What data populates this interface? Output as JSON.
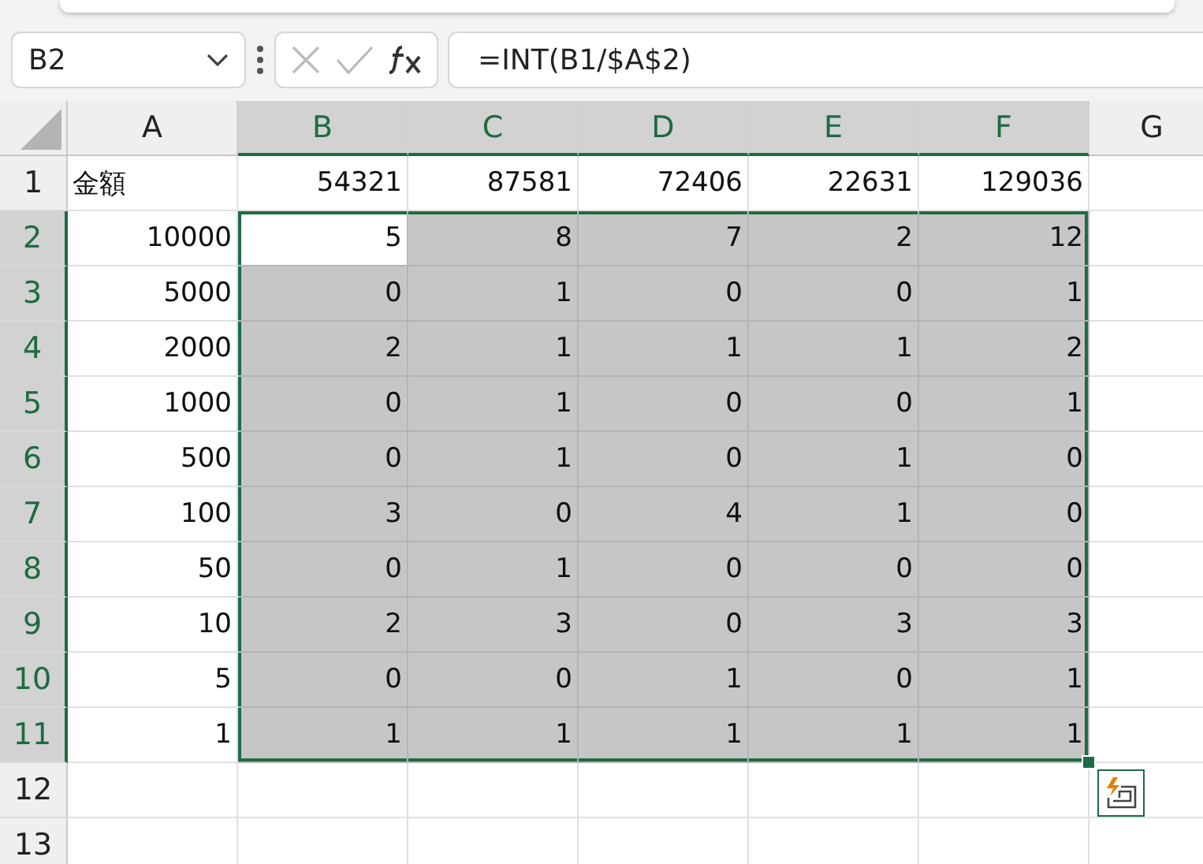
{
  "name_box": {
    "value": "B2"
  },
  "formula_bar": {
    "formula": "=INT(B1/$A$2)"
  },
  "columns": [
    {
      "label": "A",
      "selected": false
    },
    {
      "label": "B",
      "selected": true
    },
    {
      "label": "C",
      "selected": true
    },
    {
      "label": "D",
      "selected": true
    },
    {
      "label": "E",
      "selected": true
    },
    {
      "label": "F",
      "selected": true
    },
    {
      "label": "G",
      "selected": false
    }
  ],
  "rows": [
    {
      "label": "1",
      "selected": false,
      "cells": [
        {
          "value": "金額",
          "kind": "text",
          "selected": false,
          "active": false
        },
        {
          "value": "54321",
          "kind": "number",
          "selected": false,
          "active": false
        },
        {
          "value": "87581",
          "kind": "number",
          "selected": false,
          "active": false
        },
        {
          "value": "72406",
          "kind": "number",
          "selected": false,
          "active": false
        },
        {
          "value": "22631",
          "kind": "number",
          "selected": false,
          "active": false
        },
        {
          "value": "129036",
          "kind": "number",
          "selected": false,
          "active": false
        }
      ]
    },
    {
      "label": "2",
      "selected": true,
      "cells": [
        {
          "value": "10000",
          "kind": "number",
          "selected": false,
          "active": false
        },
        {
          "value": "5",
          "kind": "number",
          "selected": true,
          "active": true
        },
        {
          "value": "8",
          "kind": "number",
          "selected": true,
          "active": false
        },
        {
          "value": "7",
          "kind": "number",
          "selected": true,
          "active": false
        },
        {
          "value": "2",
          "kind": "number",
          "selected": true,
          "active": false
        },
        {
          "value": "12",
          "kind": "number",
          "selected": true,
          "active": false
        }
      ]
    },
    {
      "label": "3",
      "selected": true,
      "cells": [
        {
          "value": "5000",
          "kind": "number",
          "selected": false,
          "active": false
        },
        {
          "value": "0",
          "kind": "number",
          "selected": true,
          "active": false
        },
        {
          "value": "1",
          "kind": "number",
          "selected": true,
          "active": false
        },
        {
          "value": "0",
          "kind": "number",
          "selected": true,
          "active": false
        },
        {
          "value": "0",
          "kind": "number",
          "selected": true,
          "active": false
        },
        {
          "value": "1",
          "kind": "number",
          "selected": true,
          "active": false
        }
      ]
    },
    {
      "label": "4",
      "selected": true,
      "cells": [
        {
          "value": "2000",
          "kind": "number",
          "selected": false,
          "active": false
        },
        {
          "value": "2",
          "kind": "number",
          "selected": true,
          "active": false
        },
        {
          "value": "1",
          "kind": "number",
          "selected": true,
          "active": false
        },
        {
          "value": "1",
          "kind": "number",
          "selected": true,
          "active": false
        },
        {
          "value": "1",
          "kind": "number",
          "selected": true,
          "active": false
        },
        {
          "value": "2",
          "kind": "number",
          "selected": true,
          "active": false
        }
      ]
    },
    {
      "label": "5",
      "selected": true,
      "cells": [
        {
          "value": "1000",
          "kind": "number",
          "selected": false,
          "active": false
        },
        {
          "value": "0",
          "kind": "number",
          "selected": true,
          "active": false
        },
        {
          "value": "1",
          "kind": "number",
          "selected": true,
          "active": false
        },
        {
          "value": "0",
          "kind": "number",
          "selected": true,
          "active": false
        },
        {
          "value": "0",
          "kind": "number",
          "selected": true,
          "active": false
        },
        {
          "value": "1",
          "kind": "number",
          "selected": true,
          "active": false
        }
      ]
    },
    {
      "label": "6",
      "selected": true,
      "cells": [
        {
          "value": "500",
          "kind": "number",
          "selected": false,
          "active": false
        },
        {
          "value": "0",
          "kind": "number",
          "selected": true,
          "active": false
        },
        {
          "value": "1",
          "kind": "number",
          "selected": true,
          "active": false
        },
        {
          "value": "0",
          "kind": "number",
          "selected": true,
          "active": false
        },
        {
          "value": "1",
          "kind": "number",
          "selected": true,
          "active": false
        },
        {
          "value": "0",
          "kind": "number",
          "selected": true,
          "active": false
        }
      ]
    },
    {
      "label": "7",
      "selected": true,
      "cells": [
        {
          "value": "100",
          "kind": "number",
          "selected": false,
          "active": false
        },
        {
          "value": "3",
          "kind": "number",
          "selected": true,
          "active": false
        },
        {
          "value": "0",
          "kind": "number",
          "selected": true,
          "active": false
        },
        {
          "value": "4",
          "kind": "number",
          "selected": true,
          "active": false
        },
        {
          "value": "1",
          "kind": "number",
          "selected": true,
          "active": false
        },
        {
          "value": "0",
          "kind": "number",
          "selected": true,
          "active": false
        }
      ]
    },
    {
      "label": "8",
      "selected": true,
      "cells": [
        {
          "value": "50",
          "kind": "number",
          "selected": false,
          "active": false
        },
        {
          "value": "0",
          "kind": "number",
          "selected": true,
          "active": false
        },
        {
          "value": "1",
          "kind": "number",
          "selected": true,
          "active": false
        },
        {
          "value": "0",
          "kind": "number",
          "selected": true,
          "active": false
        },
        {
          "value": "0",
          "kind": "number",
          "selected": true,
          "active": false
        },
        {
          "value": "0",
          "kind": "number",
          "selected": true,
          "active": false
        }
      ]
    },
    {
      "label": "9",
      "selected": true,
      "cells": [
        {
          "value": "10",
          "kind": "number",
          "selected": false,
          "active": false
        },
        {
          "value": "2",
          "kind": "number",
          "selected": true,
          "active": false
        },
        {
          "value": "3",
          "kind": "number",
          "selected": true,
          "active": false
        },
        {
          "value": "0",
          "kind": "number",
          "selected": true,
          "active": false
        },
        {
          "value": "3",
          "kind": "number",
          "selected": true,
          "active": false
        },
        {
          "value": "3",
          "kind": "number",
          "selected": true,
          "active": false
        }
      ]
    },
    {
      "label": "10",
      "selected": true,
      "cells": [
        {
          "value": "5",
          "kind": "number",
          "selected": false,
          "active": false
        },
        {
          "value": "0",
          "kind": "number",
          "selected": true,
          "active": false
        },
        {
          "value": "0",
          "kind": "number",
          "selected": true,
          "active": false
        },
        {
          "value": "1",
          "kind": "number",
          "selected": true,
          "active": false
        },
        {
          "value": "0",
          "kind": "number",
          "selected": true,
          "active": false
        },
        {
          "value": "1",
          "kind": "number",
          "selected": true,
          "active": false
        }
      ]
    },
    {
      "label": "11",
      "selected": true,
      "cells": [
        {
          "value": "1",
          "kind": "number",
          "selected": false,
          "active": false
        },
        {
          "value": "1",
          "kind": "number",
          "selected": true,
          "active": false
        },
        {
          "value": "1",
          "kind": "number",
          "selected": true,
          "active": false
        },
        {
          "value": "1",
          "kind": "number",
          "selected": true,
          "active": false
        },
        {
          "value": "1",
          "kind": "number",
          "selected": true,
          "active": false
        },
        {
          "value": "1",
          "kind": "number",
          "selected": true,
          "active": false
        }
      ]
    },
    {
      "label": "12",
      "selected": false,
      "cells": []
    },
    {
      "label": "13",
      "selected": false,
      "cells": []
    }
  ]
}
